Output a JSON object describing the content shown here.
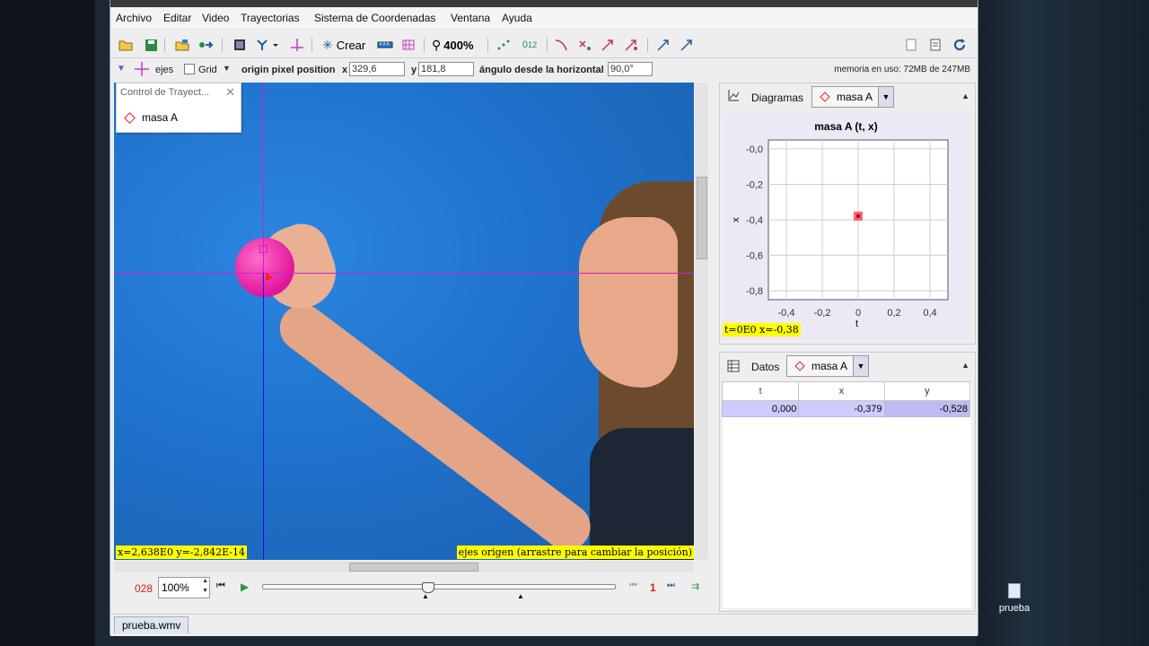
{
  "menu": [
    "Archivo",
    "Editar",
    "Video",
    "Trayectorias",
    "Sistema de Coordenadas",
    "Ventana",
    "Ayuda"
  ],
  "toolbar": {
    "crear_label": "Crear",
    "zoom_label": "400%"
  },
  "axisbar": {
    "ejes_label": "ejes",
    "grid_label": "Grid",
    "origin_label": "origin pixel position",
    "x_label": "x",
    "x_value": "329,6",
    "y_label": "y",
    "y_value": "181,8",
    "angle_label": "ángulo desde la horizontal",
    "angle_value": "90,0°",
    "memory": "memoria en uso: 72MB de 247MB"
  },
  "track_control": {
    "title": "Control de Trayect...",
    "item": "masa A"
  },
  "video": {
    "status_left": "x=2,638E0  y=-2,842E-14",
    "status_right": "ejes origen (arrastre para cambiar la posición)"
  },
  "player": {
    "frame": "028",
    "rate": "100%",
    "step": "1",
    "slider_fraction": 0.47
  },
  "tabs": [
    "prueba.wmv"
  ],
  "diagram_panel": {
    "title": "Diagramas",
    "track": "masa A",
    "readout": "t=0E0  x=-0,38",
    "chart_data": {
      "type": "scatter",
      "title": "masa A (t, x)",
      "xlabel": "t",
      "ylabel": "x",
      "xlim": [
        -0.5,
        0.5
      ],
      "ylim": [
        -0.85,
        0.05
      ],
      "x_ticks": [
        "-0,4",
        "-0,2",
        "0",
        "0,2",
        "0,4"
      ],
      "y_ticks": [
        "-0,0",
        "-0,2",
        "-0,4",
        "-0,6",
        "-0,8"
      ],
      "grid": true,
      "series": [
        {
          "color": "#ff3050",
          "points": [
            [
              0,
              -0.379
            ]
          ]
        }
      ]
    }
  },
  "data_panel": {
    "title": "Datos",
    "track": "masa A",
    "columns": [
      "t",
      "x",
      "y"
    ],
    "rows": [
      [
        "0,000",
        "-0,379",
        "-0,528"
      ]
    ]
  },
  "desktop": {
    "file_label": "prueba"
  }
}
